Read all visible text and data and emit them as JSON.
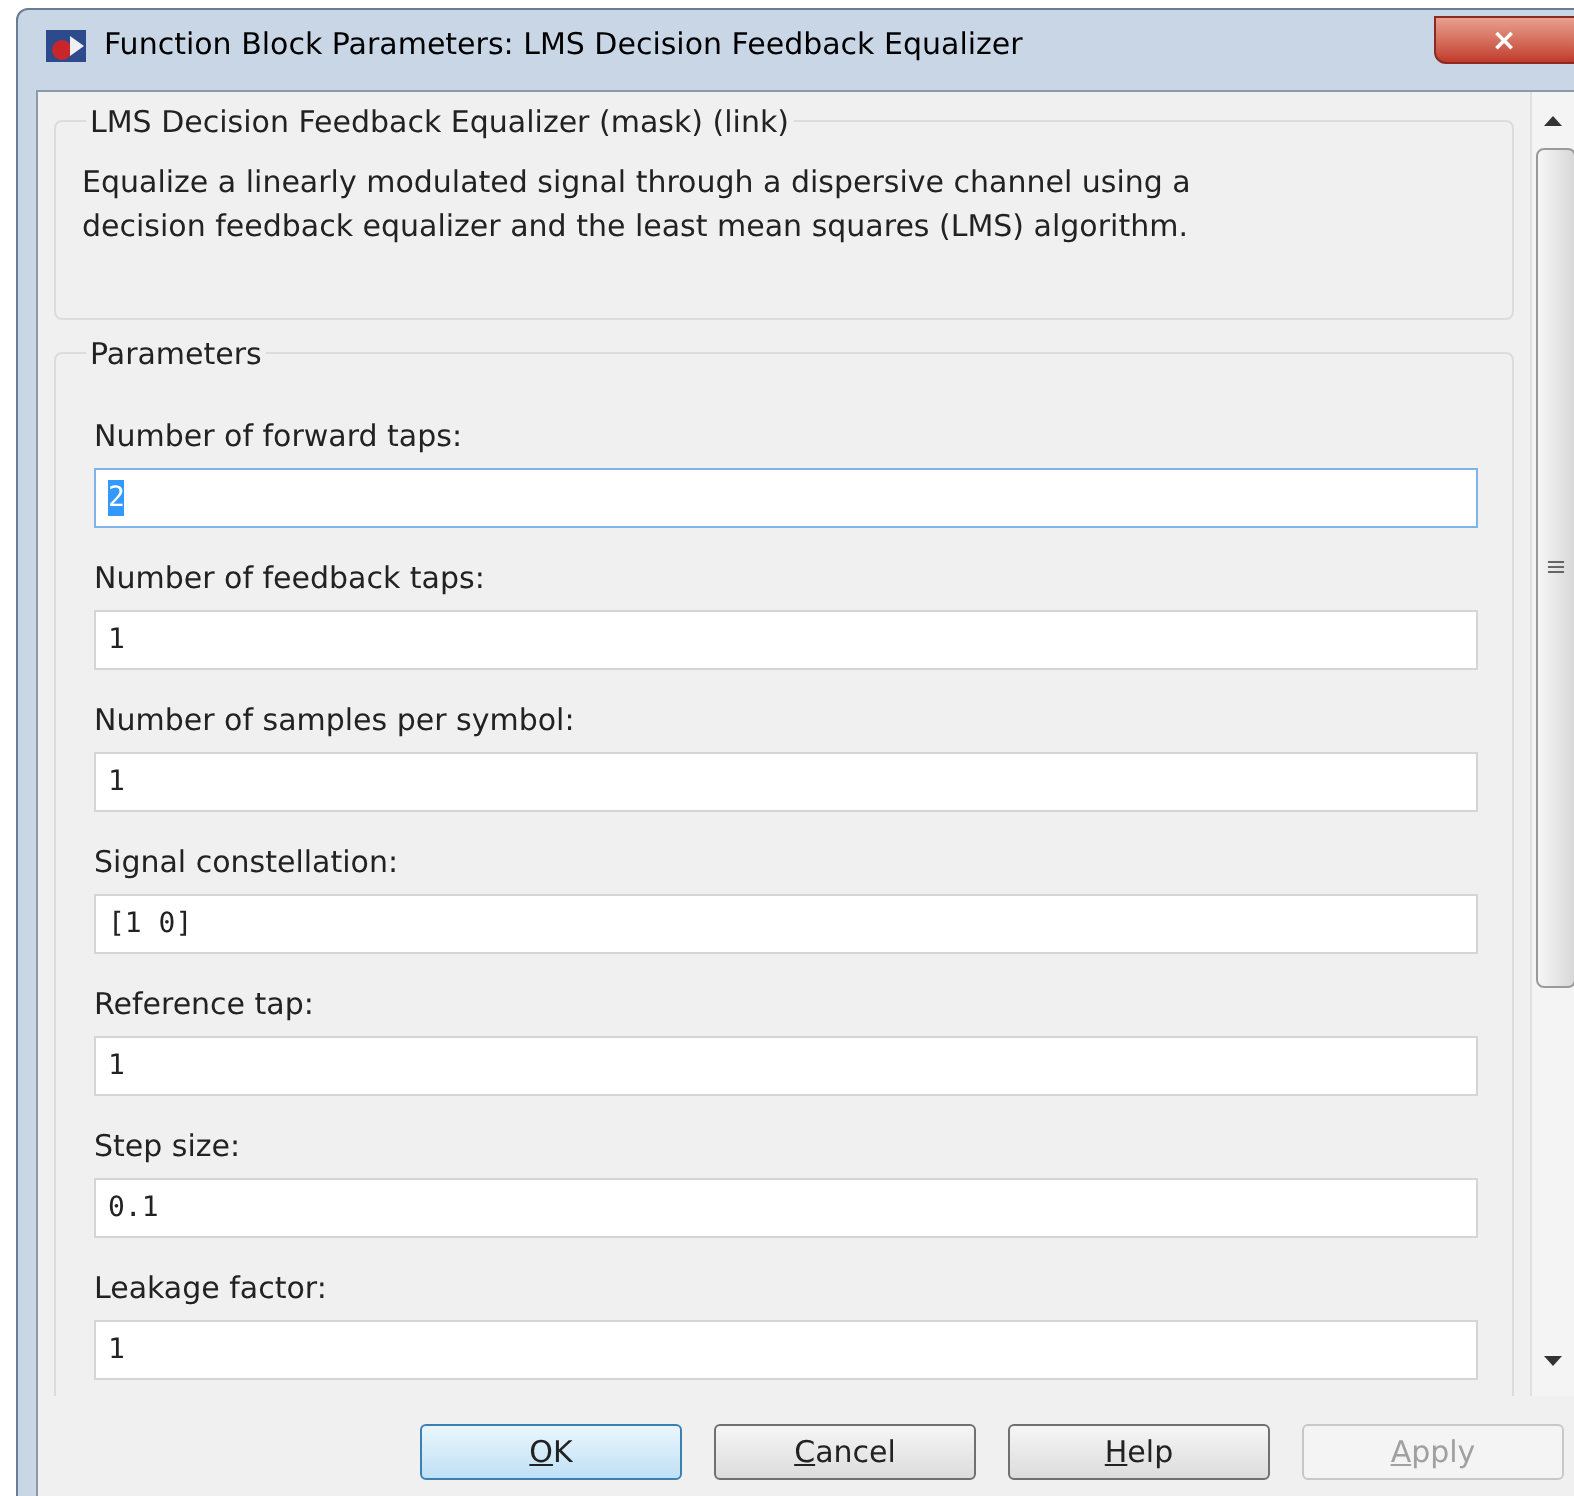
{
  "window": {
    "title": "Function Block Parameters: LMS Decision Feedback Equalizer",
    "close": "×"
  },
  "description": {
    "title": "LMS Decision Feedback Equalizer (mask) (link)",
    "text": "Equalize a linearly modulated signal through a dispersive channel using a decision feedback equalizer and the least mean squares (LMS) algorithm."
  },
  "parameters": {
    "title": "Parameters",
    "fields": [
      {
        "label": "Number of forward taps:",
        "value": "2",
        "focused": true
      },
      {
        "label": "Number of feedback taps:",
        "value": "1",
        "focused": false
      },
      {
        "label": "Number of samples per symbol:",
        "value": "1",
        "focused": false
      },
      {
        "label": "Signal constellation:",
        "value": "[1 0]",
        "focused": false
      },
      {
        "label": "Reference tap:",
        "value": "1",
        "focused": false
      },
      {
        "label": "Step size:",
        "value": "0.1",
        "focused": false
      },
      {
        "label": "Leakage factor:",
        "value": "1",
        "focused": false
      }
    ]
  },
  "buttons": [
    {
      "mnemonic": "O",
      "label": "K",
      "default": true,
      "disabled": false
    },
    {
      "mnemonic": "C",
      "label": "ancel",
      "default": false,
      "disabled": false
    },
    {
      "mnemonic": "H",
      "label": "elp",
      "default": false,
      "disabled": false
    },
    {
      "mnemonic": "A",
      "label": "pply",
      "default": false,
      "disabled": true
    }
  ]
}
